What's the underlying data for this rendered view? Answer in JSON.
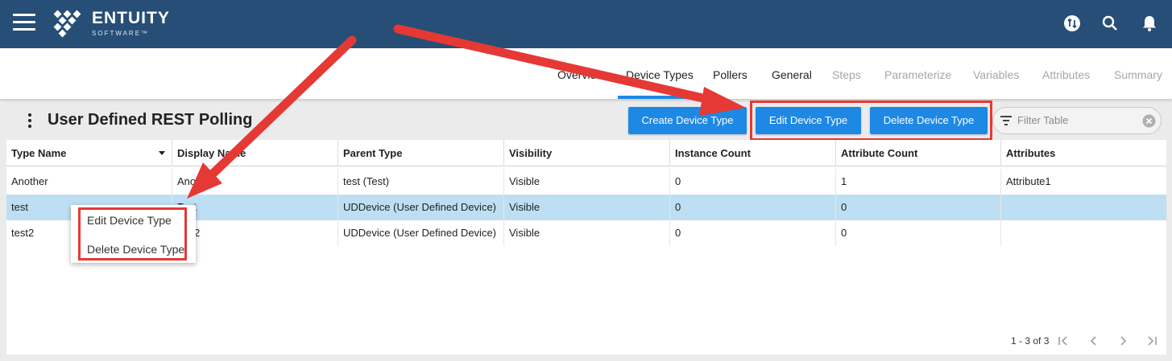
{
  "header": {
    "brand_name": "ENTUITY",
    "brand_sub": "SOFTWARE™",
    "colors": {
      "bar": "#264e76",
      "accent": "#1e88e5",
      "annotation": "#e53935",
      "selected_row": "#bedff3"
    },
    "icons": [
      "menu-icon",
      "entuity-logo",
      "sync-icon",
      "search-icon",
      "bell-icon"
    ]
  },
  "tabs": [
    {
      "label": "Overview",
      "state": "enabled"
    },
    {
      "label": "Device Types",
      "state": "active"
    },
    {
      "label": "Pollers",
      "state": "enabled"
    },
    {
      "label": "General",
      "state": "enabled"
    },
    {
      "label": "Steps",
      "state": "disabled"
    },
    {
      "label": "Parameterize",
      "state": "disabled"
    },
    {
      "label": "Variables",
      "state": "disabled"
    },
    {
      "label": "Attributes",
      "state": "disabled"
    },
    {
      "label": "Summary",
      "state": "disabled"
    }
  ],
  "toolbar": {
    "title": "User Defined REST Polling",
    "create_label": "Create Device Type",
    "edit_label": "Edit Device Type",
    "delete_label": "Delete Device Type",
    "filter_placeholder": "Filter Table"
  },
  "table": {
    "columns": [
      "Type Name",
      "Display Name",
      "Parent Type",
      "Visibility",
      "Instance Count",
      "Attribute Count",
      "Attributes"
    ],
    "rows": [
      {
        "type_name": "Another",
        "display_name": "Another",
        "parent_type": "test (Test)",
        "visibility": "Visible",
        "instance_count": "0",
        "attribute_count": "1",
        "attributes": "Attribute1",
        "selected": false
      },
      {
        "type_name": "test",
        "display_name": "Test",
        "parent_type": "UDDevice (User Defined Device)",
        "visibility": "Visible",
        "instance_count": "0",
        "attribute_count": "0",
        "attributes": "",
        "selected": true
      },
      {
        "type_name": "test2",
        "display_name": "test2",
        "parent_type": "UDDevice (User Defined Device)",
        "visibility": "Visible",
        "instance_count": "0",
        "attribute_count": "0",
        "attributes": "",
        "selected": false
      }
    ],
    "pager": "1 - 3 of 3"
  },
  "context_menu": {
    "edit_label": "Edit Device Type",
    "delete_label": "Delete Device Type"
  }
}
